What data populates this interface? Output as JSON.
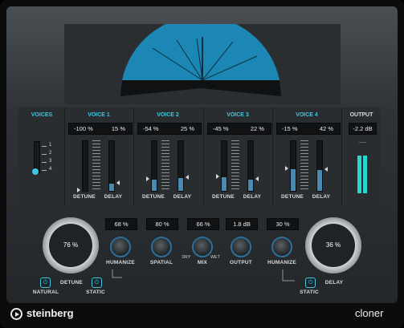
{
  "brand": "steinberg",
  "product": "cloner",
  "colors": {
    "accent": "#3fc6e0",
    "fan_fill": "#1c86b4"
  },
  "voices": {
    "header": "VOICES",
    "ticks": [
      "1",
      "2",
      "3",
      "4"
    ],
    "selected": 4
  },
  "voice_columns": [
    {
      "header": "VOICE 1",
      "detune_value": "-100 %",
      "delay_value": "15 %",
      "detune_label": "DETUNE",
      "delay_label": "DELAY",
      "detune_level": 0.0,
      "delay_level": 0.15
    },
    {
      "header": "VOICE 2",
      "detune_value": "-54 %",
      "delay_value": "25 %",
      "detune_label": "DETUNE",
      "delay_label": "DELAY",
      "detune_level": 0.23,
      "delay_level": 0.25
    },
    {
      "header": "VOICE 3",
      "detune_value": "-45 %",
      "delay_value": "22 %",
      "detune_label": "DETUNE",
      "delay_label": "DELAY",
      "detune_level": 0.28,
      "delay_level": 0.22
    },
    {
      "header": "VOICE 4",
      "detune_value": "-15 %",
      "delay_value": "42 %",
      "detune_label": "DETUNE",
      "delay_label": "DELAY",
      "detune_level": 0.43,
      "delay_level": 0.42
    }
  ],
  "output_section": {
    "header": "OUTPUT",
    "value": "-2.2 dB"
  },
  "bottom": {
    "natural_label": "NATURAL",
    "detune_label": "DETUNE",
    "static_left_label": "STATIC",
    "static_right_label": "STATIC",
    "delay_label": "DELAY",
    "detune_knob_value": "76 %",
    "delay_knob_value": "36 %",
    "knobs": [
      {
        "id": "humanize-left",
        "value": "68 %",
        "label": "HUMANIZE"
      },
      {
        "id": "spatial",
        "value": "80 %",
        "label": "SPATIAL"
      },
      {
        "id": "mix",
        "value": "66 %",
        "label": "MIX",
        "sub_left": "DRY",
        "sub_right": "WET"
      },
      {
        "id": "output",
        "value": "1.8 dB",
        "label": "OUTPUT"
      },
      {
        "id": "humanize-right",
        "value": "30 %",
        "label": "HUMANIZE"
      }
    ]
  }
}
